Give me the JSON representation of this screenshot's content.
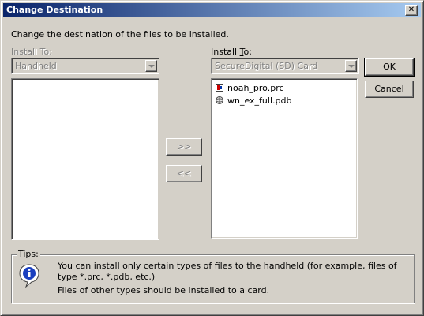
{
  "window": {
    "title": "Change Destination",
    "close_glyph": "✕"
  },
  "instructions": "Change the destination of the files to be installed.",
  "left_panel": {
    "label": "Install To:",
    "combo_value": "Handheld",
    "files": []
  },
  "right_panel": {
    "label_prefix": "Install ",
    "label_underlined": "T",
    "label_suffix": "o:",
    "combo_value": "SecureDigital (SD) Card",
    "files": [
      {
        "name": "noah_pro.prc",
        "icon": "prc-file-icon"
      },
      {
        "name": "wn_ex_full.pdb",
        "icon": "pdb-file-icon"
      }
    ]
  },
  "buttons": {
    "ok": "OK",
    "cancel": "Cancel",
    "move_right": ">>",
    "move_left": "<<"
  },
  "tips": {
    "label": "Tips:",
    "icon": "info-icon",
    "line1": "You can install only certain types of files to the handheld (for example, files of",
    "line2": "type *.prc, *.pdb, etc.)",
    "line3": "Files of other types should be installed to a card."
  }
}
